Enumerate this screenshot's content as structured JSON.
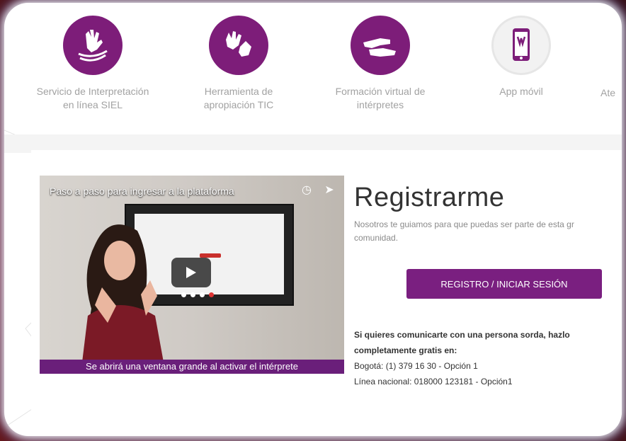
{
  "services": [
    {
      "label_line1": "Servicio de Interpretación",
      "label_line2": "en línea SIEL",
      "icon": "hand-sign-icon"
    },
    {
      "label_line1": "Herramienta de",
      "label_line2": "apropiación TIC",
      "icon": "hands-sign-icon"
    },
    {
      "label_line1": "Formación virtual de",
      "label_line2": "intérpretes",
      "icon": "hands-gesture-icon"
    },
    {
      "label_line1": "App móvil",
      "label_line2": "",
      "icon": "mobile-app-icon"
    },
    {
      "label_line1": "Ate",
      "label_line2": "",
      "icon": ""
    }
  ],
  "video": {
    "title": "Paso a paso para ingresar a la plataforma",
    "caption": "Se abrirá una ventana grande al activar el intérprete"
  },
  "register": {
    "title": "Registrarme",
    "subtitle_line1": "Nosotros te guiamos para que puedas ser parte de esta gr",
    "subtitle_line2": "comunidad.",
    "button": "REGISTRO / INICIAR SESIÓN"
  },
  "contact": {
    "line1": "Si quieres comunicarte con una persona sorda, hazlo",
    "line2": "completamente gratis en:",
    "line3": "Bogotá: (1) 379 16 30 - Opción 1",
    "line4": "Línea nacional: 018000 123181 - Opción1"
  },
  "colors": {
    "brand_purple": "#7d1d79",
    "backdrop_red": "#6e1712"
  }
}
